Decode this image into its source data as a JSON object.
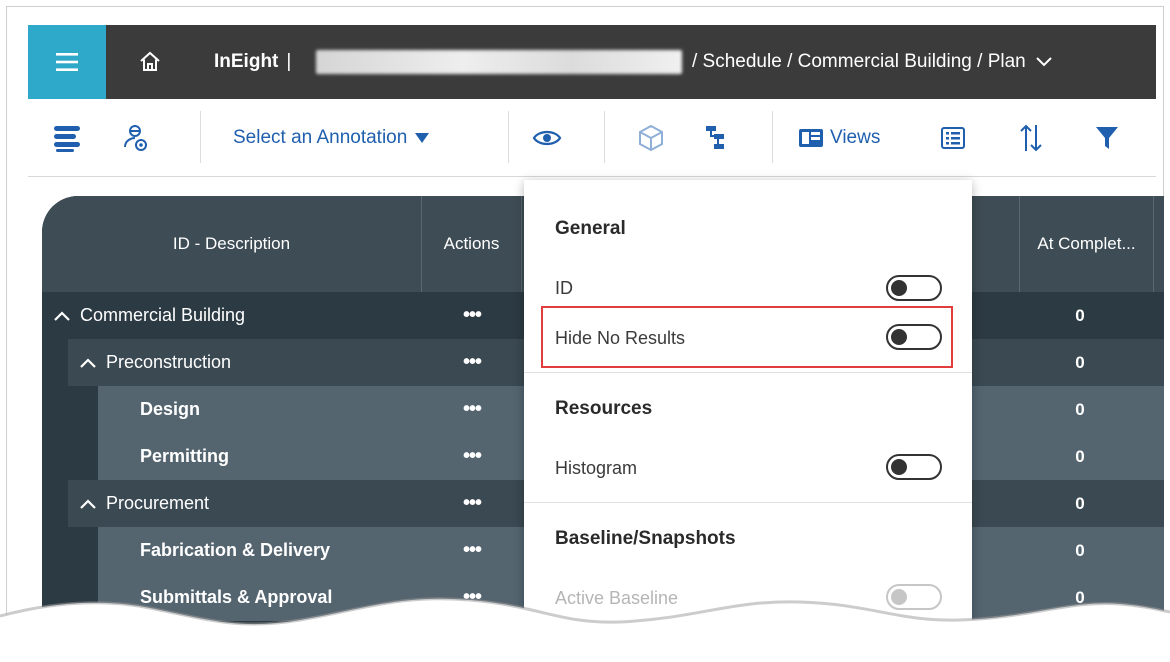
{
  "header": {
    "brand": "InEight",
    "separator": "|",
    "breadcrumb": "/ Schedule / Commercial Building / Plan"
  },
  "toolbar": {
    "annotation_select": "Select an Annotation",
    "views_label": "Views"
  },
  "grid": {
    "columns": [
      "ID - Description",
      "Actions",
      "At Complet..."
    ],
    "rows": [
      {
        "label": "Commercial Building",
        "expandable": true,
        "level": 0,
        "value": "0"
      },
      {
        "label": "Preconstruction",
        "expandable": true,
        "level": 1,
        "value": "0"
      },
      {
        "label": "Design",
        "expandable": false,
        "level": 2,
        "value": "0"
      },
      {
        "label": "Permitting",
        "expandable": false,
        "level": 2,
        "value": "0"
      },
      {
        "label": "Procurement",
        "expandable": true,
        "level": 1,
        "value": "0"
      },
      {
        "label": "Fabrication & Delivery",
        "expandable": false,
        "level": 2,
        "value": "0"
      },
      {
        "label": "Submittals & Approval",
        "expandable": false,
        "level": 2,
        "value": "0"
      }
    ],
    "actions_glyph": "•••",
    "expand_glyph": "^"
  },
  "panel": {
    "sections": [
      {
        "title": "General",
        "options": [
          {
            "label": "ID",
            "on": false
          },
          {
            "label": "Hide No Results",
            "on": false,
            "highlighted": true
          }
        ]
      },
      {
        "title": "Resources",
        "options": [
          {
            "label": "Histogram",
            "on": false
          }
        ]
      },
      {
        "title": "Baseline/Snapshots",
        "options": [
          {
            "label": "Active Baseline",
            "on": false,
            "disabled": true
          }
        ]
      }
    ]
  },
  "colors": {
    "accent": "#2fa9c9",
    "header_bg": "#3b3b3b",
    "link_blue": "#1f5fae",
    "highlight_red": "#e23d3d"
  }
}
